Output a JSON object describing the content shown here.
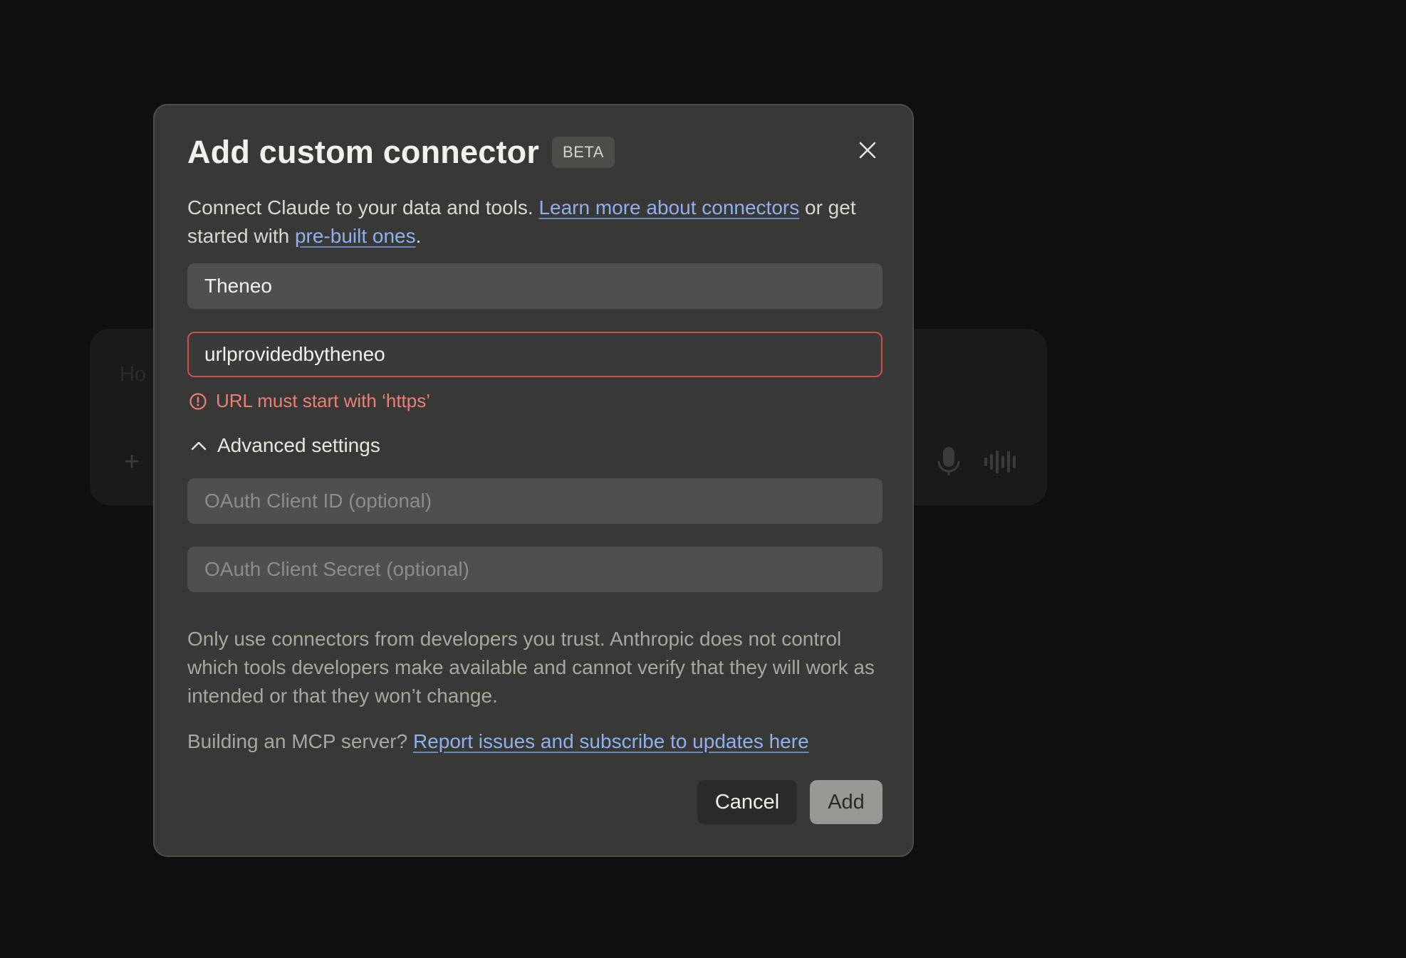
{
  "background": {
    "composer_placeholder": "Ho"
  },
  "modal": {
    "title": "Add custom connector",
    "badge": "BETA",
    "description": {
      "part1": "Connect Claude to your data and tools. ",
      "link1": "Learn more about connectors",
      "part2": " or get started with ",
      "link2": "pre-built ones",
      "part3": "."
    },
    "name_field": {
      "value": "Theneo"
    },
    "url_field": {
      "value": "urlprovidedbytheneo",
      "error": "URL must start with ‘https’"
    },
    "advanced_settings": {
      "label": "Advanced settings",
      "expanded": true
    },
    "client_id_field": {
      "placeholder": "OAuth Client ID (optional)"
    },
    "client_secret_field": {
      "placeholder": "OAuth Client Secret (optional)"
    },
    "disclaimer": "Only use connectors from developers you trust. Anthropic does not control which tools developers make available and cannot verify that they will work as intended or that they won’t change.",
    "mcp": {
      "prefix": "Building an MCP server? ",
      "link": "Report issues and subscribe to updates here"
    },
    "buttons": {
      "cancel": "Cancel",
      "add": "Add"
    }
  },
  "colors": {
    "modal_bg": "#383836",
    "link": "#8fb0ef",
    "error": "#ec7f74",
    "error_border": "#c9524b"
  },
  "icons": [
    "close-icon",
    "error-circle-icon",
    "chevron-up-icon",
    "plus-icon",
    "microphone-icon",
    "waveform-icon"
  ]
}
